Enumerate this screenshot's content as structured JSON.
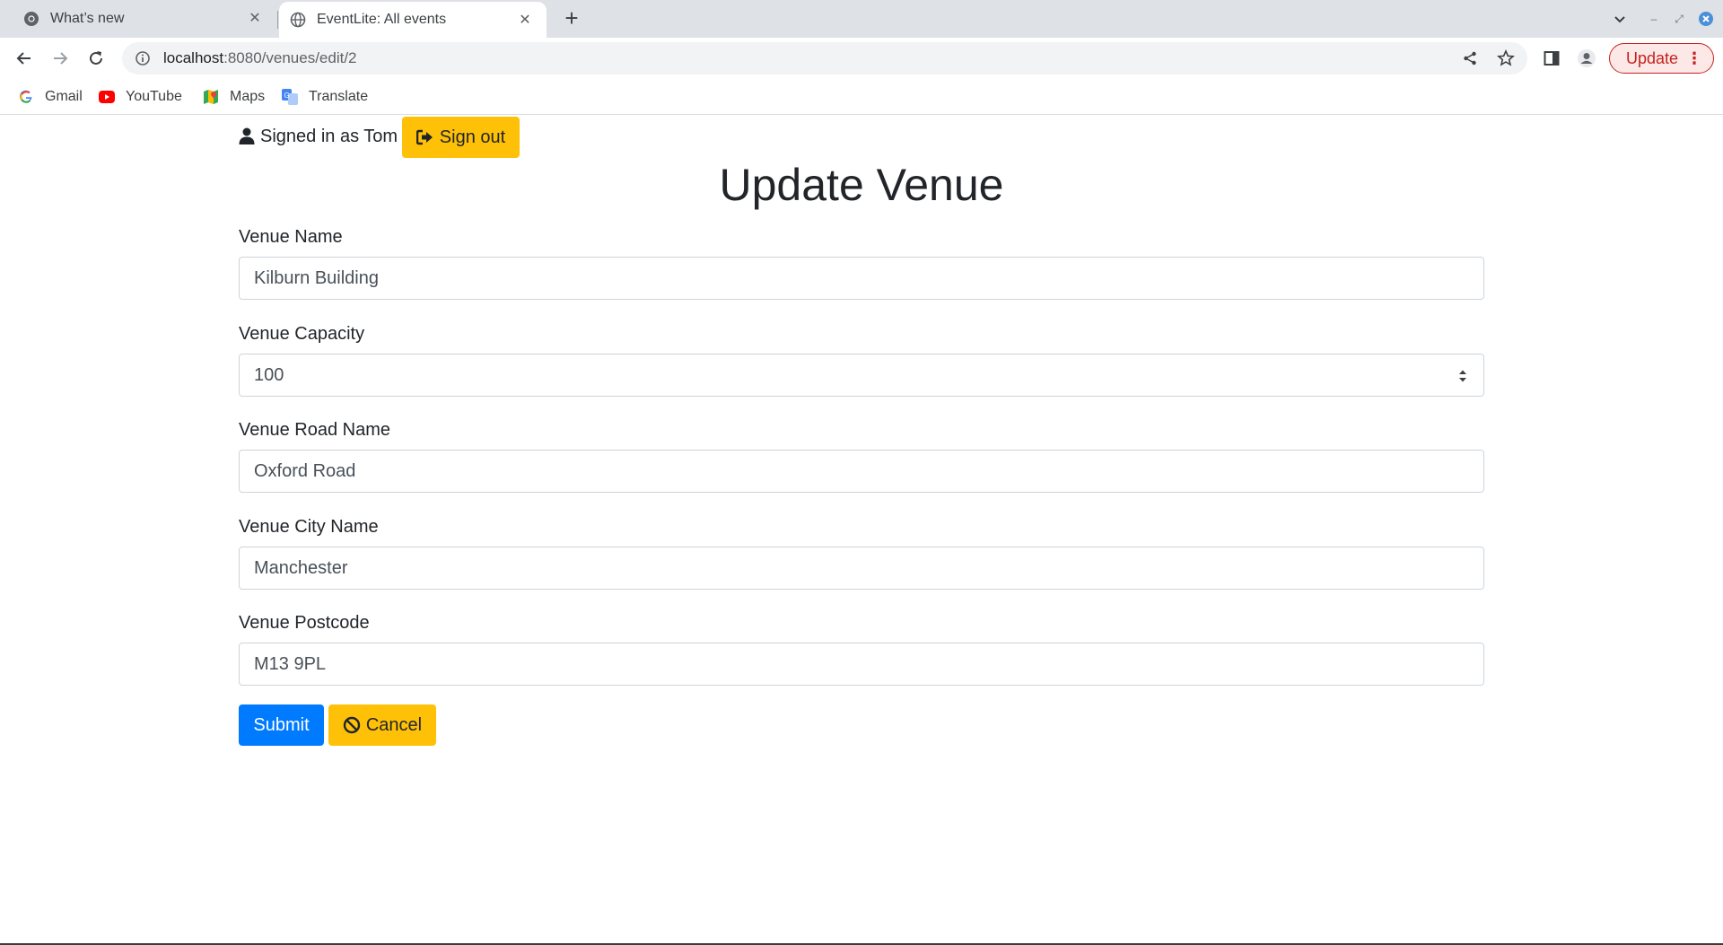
{
  "browser": {
    "tabs": [
      {
        "title": "What’s new",
        "icon": "chrome-icon",
        "active": false
      },
      {
        "title": "EventLite: All events",
        "icon": "globe-icon",
        "active": true
      }
    ],
    "url_host": "localhost",
    "url_path": ":8080/venues/edit/2",
    "update_label": "Update",
    "bookmarks": [
      {
        "label": "Gmail",
        "icon": "google-icon"
      },
      {
        "label": "YouTube",
        "icon": "youtube-icon"
      },
      {
        "label": "Maps",
        "icon": "maps-icon"
      },
      {
        "label": "Translate",
        "icon": "translate-icon"
      }
    ]
  },
  "page": {
    "signed_in_text": "Signed in as Tom",
    "signout_label": "Sign out",
    "title": "Update Venue",
    "fields": [
      {
        "label": "Venue Name",
        "value": "Kilburn Building"
      },
      {
        "label": "Venue Capacity",
        "value": "100"
      },
      {
        "label": "Venue Road Name",
        "value": "Oxford Road"
      },
      {
        "label": "Venue City Name",
        "value": "Manchester"
      },
      {
        "label": "Venue Postcode",
        "value": "M13 9PL"
      }
    ],
    "submit_label": "Submit",
    "cancel_label": "Cancel"
  },
  "colors": {
    "warning": "#ffc107",
    "primary": "#007bff",
    "update_red": "#c5221f"
  }
}
